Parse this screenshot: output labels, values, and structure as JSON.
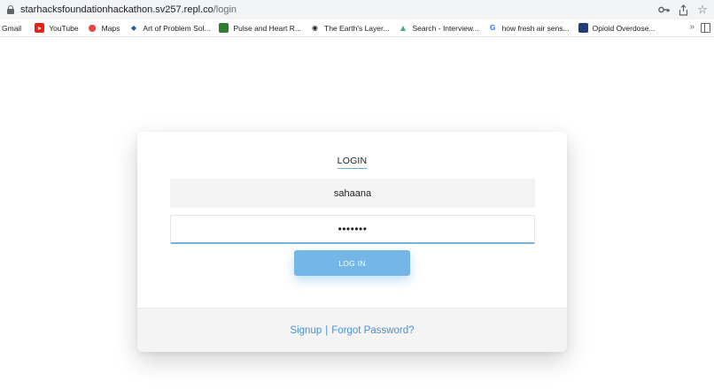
{
  "browser": {
    "url_host": "starhacksfoundationhackathon.sv257.repl.co",
    "url_path": "/login",
    "bookmarks": [
      {
        "label": "Gmail",
        "icon": "gmail-icon"
      },
      {
        "label": "YouTube",
        "icon": "youtube-icon"
      },
      {
        "label": "Maps",
        "icon": "maps-icon"
      },
      {
        "label": "Art of Problem Sol...",
        "icon": "aops-icon"
      },
      {
        "label": "Pulse and Heart R...",
        "icon": "pulse-icon"
      },
      {
        "label": "The Earth's Layer...",
        "icon": "globe-icon"
      },
      {
        "label": "Search - Interview...",
        "icon": "search-site-icon"
      },
      {
        "label": "how fresh air sens...",
        "icon": "google-icon"
      },
      {
        "label": "Opioid Overdose...",
        "icon": "opioid-icon"
      }
    ],
    "more_label": "»"
  },
  "login": {
    "title": "LOGIN",
    "username_value": "sahaana",
    "password_value": "•••••••",
    "button_label": "LOG IN",
    "signup_label": "Signup",
    "separator": "|",
    "forgot_label": "Forgot Password?"
  },
  "colors": {
    "accent": "#74b7e6",
    "link": "#4a90d9",
    "footer_bg": "#f4f4f4"
  }
}
